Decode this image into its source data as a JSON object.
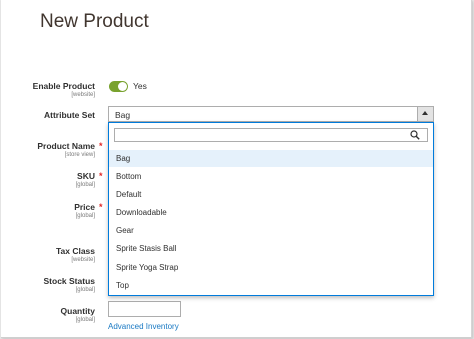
{
  "page_title": "New Product",
  "fields": {
    "enable_product": {
      "label": "Enable Product",
      "scope": "[website]",
      "value": "Yes"
    },
    "attribute_set": {
      "label": "Attribute Set",
      "value": "Bag"
    },
    "product_name": {
      "label": "Product Name",
      "scope": "[store view]",
      "required_mark": "*"
    },
    "sku": {
      "label": "SKU",
      "scope": "[global]",
      "required_mark": "*"
    },
    "price": {
      "label": "Price",
      "scope": "[global]",
      "required_mark": "*"
    },
    "tax_class": {
      "label": "Tax Class",
      "scope": "[website]"
    },
    "stock_status": {
      "label": "Stock Status",
      "scope": "[global]"
    },
    "quantity": {
      "label": "Quantity",
      "scope": "[global]",
      "link": "Advanced Inventory"
    }
  },
  "dropdown": {
    "search_value": "",
    "options": [
      "Bag",
      "Bottom",
      "Default",
      "Downloadable",
      "Gear",
      "Sprite Stasis Ball",
      "Sprite Yoga Strap",
      "Top"
    ],
    "selected": "Bag"
  },
  "colors": {
    "toggle_on": "#79a22e",
    "focus_border": "#007bdb",
    "required": "#e22626",
    "link": "#1979c3",
    "selected_option_bg": "#e5f1fb"
  },
  "icons": {
    "search": "search-icon",
    "dropdown_arrow": "chevron-up-icon"
  }
}
